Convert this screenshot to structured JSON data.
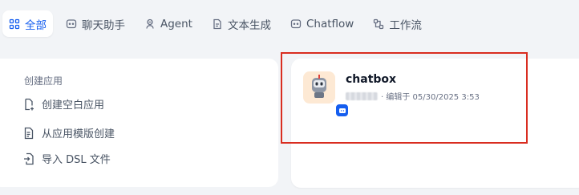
{
  "tabs": [
    {
      "label": "全部",
      "icon": "grid-icon",
      "active": true
    },
    {
      "label": "聊天助手",
      "icon": "chat-bubble-icon",
      "active": false
    },
    {
      "label": "Agent",
      "icon": "robot-icon",
      "active": false
    },
    {
      "label": "文本生成",
      "icon": "document-icon",
      "active": false
    },
    {
      "label": "Chatflow",
      "icon": "chatflow-icon",
      "active": false
    },
    {
      "label": "工作流",
      "icon": "workflow-icon",
      "active": false
    }
  ],
  "create": {
    "title": "创建应用",
    "items": [
      {
        "label": "创建空白应用",
        "icon": "file-plus-icon"
      },
      {
        "label": "从应用模版创建",
        "icon": "template-icon"
      },
      {
        "label": "导入 DSL 文件",
        "icon": "file-import-icon"
      }
    ]
  },
  "app": {
    "name": "chatbox",
    "meta": "· 编辑于 05/30/2025 3:53",
    "badge_icon": "chat-badge-icon",
    "avatar_icon": "robot-avatar-icon"
  },
  "colors": {
    "accent": "#155eef",
    "background": "#f2f4f7",
    "highlight": "#d92d20",
    "avatar_bg": "#fde9d4"
  }
}
